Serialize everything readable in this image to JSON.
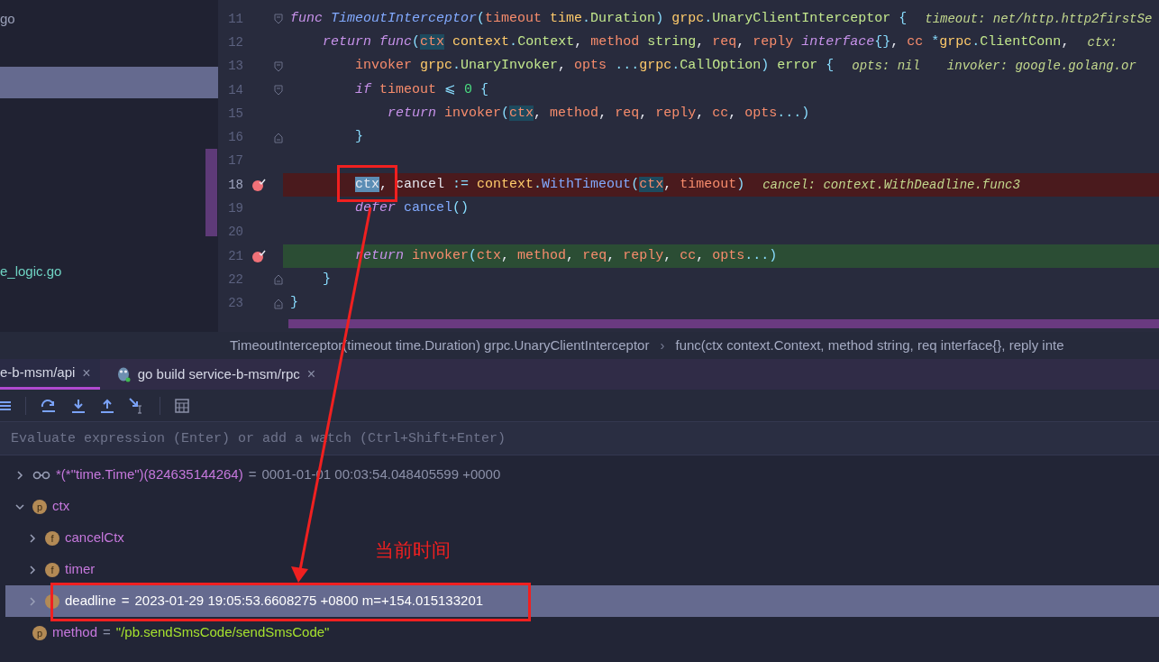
{
  "project_tree": {
    "rows": [
      {
        "label": "go",
        "selected": false
      },
      {
        "selected": false
      },
      {
        "selected": true
      },
      {
        "selected": false
      },
      {
        "selected": false
      },
      {
        "selected": false
      },
      {
        "selected": false
      },
      {
        "selected": false
      },
      {
        "label": "e_logic.go",
        "selected": false
      }
    ]
  },
  "editor": {
    "lines": [
      {
        "number": "11",
        "fold_start": true,
        "fold_end": false,
        "breakpoint": false,
        "kind": "normal",
        "tokens": [
          {
            "text": "func ",
            "kind": "keyword"
          },
          {
            "text": "TimeoutInterceptor",
            "kind": "fname"
          },
          {
            "text": "(",
            "kind": "punct"
          },
          {
            "text": "timeout ",
            "kind": "param"
          },
          {
            "text": "time",
            "kind": "pkg"
          },
          {
            "text": ".",
            "kind": "punct"
          },
          {
            "text": "Duration",
            "kind": "type"
          },
          {
            "text": ") ",
            "kind": "punct"
          },
          {
            "text": "grpc",
            "kind": "pkg"
          },
          {
            "text": ".",
            "kind": "punct"
          },
          {
            "text": "UnaryClientInterceptor",
            "kind": "type"
          },
          {
            "text": " {",
            "kind": "punct"
          }
        ],
        "hints": [
          "timeout: net/http.http2firstSe"
        ]
      },
      {
        "number": "12",
        "fold_start": false,
        "fold_end": false,
        "breakpoint": false,
        "kind": "normal",
        "tokens": [
          {
            "text": "    return ",
            "kind": "keyword"
          },
          {
            "text": "func",
            "kind": "keyword"
          },
          {
            "text": "(",
            "kind": "punct"
          },
          {
            "text": "ctx",
            "kind": "usage"
          },
          {
            "text": " context",
            "kind": "pkg"
          },
          {
            "text": ".",
            "kind": "punct"
          },
          {
            "text": "Context",
            "kind": "type"
          },
          {
            "text": ", ",
            "kind": "plain"
          },
          {
            "text": "method ",
            "kind": "param"
          },
          {
            "text": "string",
            "kind": "type"
          },
          {
            "text": ", ",
            "kind": "plain"
          },
          {
            "text": "req",
            "kind": "param"
          },
          {
            "text": ", ",
            "kind": "plain"
          },
          {
            "text": "reply ",
            "kind": "param"
          },
          {
            "text": "interface",
            "kind": "keyword"
          },
          {
            "text": "{}",
            "kind": "punct"
          },
          {
            "text": ", ",
            "kind": "plain"
          },
          {
            "text": "cc ",
            "kind": "param"
          },
          {
            "text": "*",
            "kind": "punct"
          },
          {
            "text": "grpc",
            "kind": "pkg"
          },
          {
            "text": ".",
            "kind": "punct"
          },
          {
            "text": "ClientConn",
            "kind": "type"
          },
          {
            "text": ",",
            "kind": "plain"
          }
        ],
        "hints": [
          "ctx:"
        ]
      },
      {
        "number": "13",
        "fold_start": true,
        "fold_end": false,
        "breakpoint": false,
        "kind": "normal",
        "tokens": [
          {
            "text": "        invoker ",
            "kind": "param"
          },
          {
            "text": "grpc",
            "kind": "pkg"
          },
          {
            "text": ".",
            "kind": "punct"
          },
          {
            "text": "UnaryInvoker",
            "kind": "type"
          },
          {
            "text": ", ",
            "kind": "plain"
          },
          {
            "text": "opts ",
            "kind": "param"
          },
          {
            "text": "...",
            "kind": "punct"
          },
          {
            "text": "grpc",
            "kind": "pkg"
          },
          {
            "text": ".",
            "kind": "punct"
          },
          {
            "text": "CallOption",
            "kind": "type"
          },
          {
            "text": ") ",
            "kind": "punct"
          },
          {
            "text": "error ",
            "kind": "type"
          },
          {
            "text": "{",
            "kind": "punct"
          }
        ],
        "hints": [
          "opts: nil",
          "invoker: google.golang.or"
        ]
      },
      {
        "number": "14",
        "fold_start": true,
        "fold_end": false,
        "breakpoint": false,
        "kind": "normal",
        "tokens": [
          {
            "text": "        if ",
            "kind": "keyword"
          },
          {
            "text": "timeout ",
            "kind": "param"
          },
          {
            "text": "⩽ ",
            "kind": "punct"
          },
          {
            "text": "0 ",
            "kind": "number"
          },
          {
            "text": "{",
            "kind": "punct"
          }
        ]
      },
      {
        "number": "15",
        "fold_start": false,
        "fold_end": false,
        "breakpoint": false,
        "kind": "normal",
        "tokens": [
          {
            "text": "            return ",
            "kind": "keyword"
          },
          {
            "text": "invoker",
            "kind": "param"
          },
          {
            "text": "(",
            "kind": "punct"
          },
          {
            "text": "ctx",
            "kind": "usage"
          },
          {
            "text": ", ",
            "kind": "plain"
          },
          {
            "text": "method",
            "kind": "param"
          },
          {
            "text": ", ",
            "kind": "plain"
          },
          {
            "text": "req",
            "kind": "param"
          },
          {
            "text": ", ",
            "kind": "plain"
          },
          {
            "text": "reply",
            "kind": "param"
          },
          {
            "text": ", ",
            "kind": "plain"
          },
          {
            "text": "cc",
            "kind": "param"
          },
          {
            "text": ", ",
            "kind": "plain"
          },
          {
            "text": "opts",
            "kind": "param"
          },
          {
            "text": "...)",
            "kind": "punct"
          }
        ]
      },
      {
        "number": "16",
        "fold_start": false,
        "fold_end": true,
        "breakpoint": false,
        "kind": "normal",
        "tokens": [
          {
            "text": "        }",
            "kind": "punct"
          }
        ]
      },
      {
        "number": "17",
        "fold_start": false,
        "fold_end": false,
        "breakpoint": false,
        "kind": "normal"
      },
      {
        "number": "18",
        "fold_start": false,
        "fold_end": false,
        "breakpoint": true,
        "kind": "breakpoint",
        "tokens": [
          {
            "text": "        ctx",
            "kind": "selection"
          },
          {
            "text": ", cancel ",
            "kind": "plain"
          },
          {
            "text": ":= ",
            "kind": "punct"
          },
          {
            "text": "context",
            "kind": "pkg"
          },
          {
            "text": ".",
            "kind": "punct"
          },
          {
            "text": "WithTimeout",
            "kind": "call"
          },
          {
            "text": "(",
            "kind": "punct"
          },
          {
            "text": "ctx",
            "kind": "usage"
          },
          {
            "text": ", ",
            "kind": "plain"
          },
          {
            "text": "timeout",
            "kind": "param"
          },
          {
            "text": ")",
            "kind": "punct"
          }
        ],
        "hints": [
          "cancel: context.WithDeadline.func3"
        ]
      },
      {
        "number": "19",
        "fold_start": false,
        "fold_end": false,
        "breakpoint": false,
        "kind": "normal",
        "tokens": [
          {
            "text": "        defer ",
            "kind": "keyword"
          },
          {
            "text": "cancel",
            "kind": "call"
          },
          {
            "text": "()",
            "kind": "punct"
          }
        ]
      },
      {
        "number": "20",
        "fold_start": false,
        "fold_end": false,
        "breakpoint": false,
        "kind": "normal"
      },
      {
        "number": "21",
        "fold_start": false,
        "fold_end": false,
        "breakpoint": true,
        "kind": "execution",
        "tokens": [
          {
            "text": "        return ",
            "kind": "keyword"
          },
          {
            "text": "invoker",
            "kind": "param"
          },
          {
            "text": "(",
            "kind": "punct"
          },
          {
            "text": "ctx",
            "kind": "param"
          },
          {
            "text": ", ",
            "kind": "plain"
          },
          {
            "text": "method",
            "kind": "param"
          },
          {
            "text": ", ",
            "kind": "plain"
          },
          {
            "text": "req",
            "kind": "param"
          },
          {
            "text": ", ",
            "kind": "plain"
          },
          {
            "text": "reply",
            "kind": "param"
          },
          {
            "text": ", ",
            "kind": "plain"
          },
          {
            "text": "cc",
            "kind": "param"
          },
          {
            "text": ", ",
            "kind": "plain"
          },
          {
            "text": "opts",
            "kind": "param"
          },
          {
            "text": "...)",
            "kind": "punct"
          }
        ]
      },
      {
        "number": "22",
        "fold_start": false,
        "fold_end": true,
        "breakpoint": false,
        "kind": "normal",
        "tokens": [
          {
            "text": "    }",
            "kind": "punct"
          }
        ]
      },
      {
        "number": "23",
        "fold_start": false,
        "fold_end": true,
        "breakpoint": false,
        "kind": "normal",
        "tokens": [
          {
            "text": "}",
            "kind": "punct"
          }
        ]
      }
    ]
  },
  "breadcrumb": [
    "TimeoutInterceptor(timeout time.Duration) grpc.UnaryClientInterceptor",
    "func(ctx context.Context, method string, req interface{}, reply inte"
  ],
  "breadcrumb_separator": "›",
  "debug_tabs": [
    {
      "label": "e-b-msm/api",
      "selected": true,
      "close": "×"
    },
    {
      "label": "go build service-b-msm/rpc",
      "selected": false,
      "close": "×"
    }
  ],
  "evaluate_field": {
    "placeholder": "Evaluate expression (Enter) or add a watch (Ctrl+Shift+Enter)"
  },
  "variables": [
    {
      "kind": "watch",
      "expandable": true,
      "expanded": false,
      "selected": false,
      "name": "*(*\"time.Time\")(824635144264)",
      "separator": "=",
      "value": "0001-01-01 00:03:54.048405599 +0000",
      "quoted": false
    },
    {
      "kind": "variable",
      "badge": "p",
      "expandable": true,
      "expanded": true,
      "selected": false,
      "name": "ctx",
      "children": [
        {
          "kind": "variable",
          "badge": "f",
          "expandable": true,
          "expanded": false,
          "selected": false,
          "name": "cancelCtx"
        },
        {
          "kind": "variable",
          "badge": "f",
          "expandable": true,
          "expanded": false,
          "selected": false,
          "name": "timer"
        },
        {
          "kind": "variable",
          "expandable": true,
          "expanded": false,
          "selected": true,
          "name": "deadline",
          "separator": "=",
          "value": "2023-01-29 19:05:53.6608275 +0800 m=+154.015133201"
        }
      ]
    },
    {
      "kind": "variable",
      "badge": "p",
      "expandable": false,
      "expanded": false,
      "selected": false,
      "name": "method",
      "separator": "=",
      "value": "\"/pb.sendSmsCode/sendSmsCode\"",
      "quoted": true
    }
  ],
  "annotation": {
    "note": "当前时间"
  }
}
